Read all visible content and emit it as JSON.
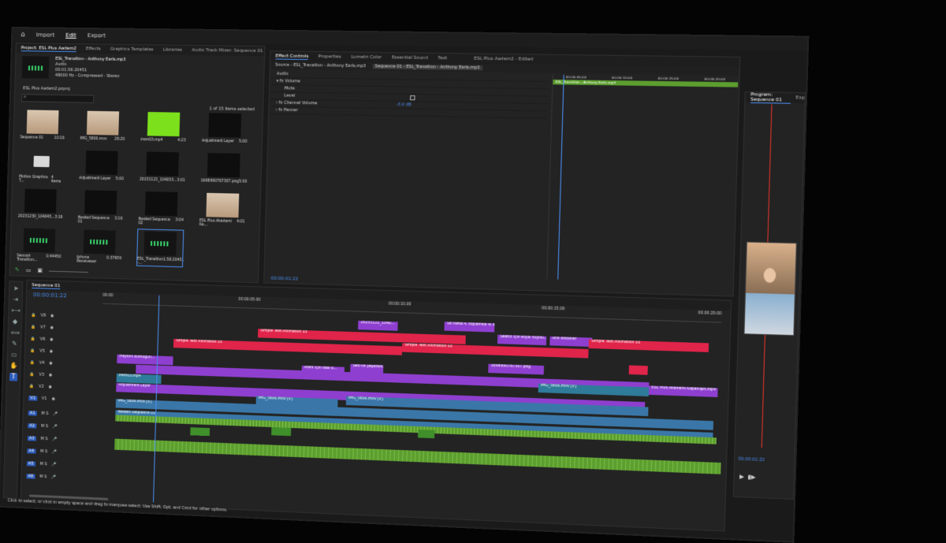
{
  "workspace": {
    "home": "⌂",
    "import": "Import",
    "edit": "Edit",
    "export": "Export"
  },
  "project": {
    "tabs": [
      "Project: ESL Plus Aadem2",
      "Effects",
      "Graphics Templates",
      "Libraries",
      "Audio Track Mixer: Sequence 01"
    ],
    "preview_name": "ESL_Transition - Anthony Earls.mp3",
    "preview_type": "Audio",
    "preview_duration": "00:01:56:20451",
    "preview_info": "48000 Hz - Compressed - Stereo",
    "file": "ESL Plus Aadem2.prproj",
    "count": "1 of 15 items selected",
    "items": [
      {
        "name": "Sequence 01",
        "dur": "",
        "kind": "face"
      },
      {
        "name": "",
        "dur": "10:16",
        "kind": ""
      },
      {
        "name": "IMG_5800.mov",
        "dur": "28:20",
        "kind": "face"
      },
      {
        "name": "irem03.mp4",
        "dur": "4:23",
        "kind": "green"
      },
      {
        "name": "Adjustment Layer",
        "dur": "5:00",
        "kind": ""
      },
      {
        "name": "Motion Graphics T...",
        "dur": "4 items",
        "kind": "folder"
      },
      {
        "name": "Adjustment Layer",
        "dur": "5:00",
        "kind": ""
      },
      {
        "name": "20231121_104033...",
        "dur": "3:01",
        "kind": ""
      },
      {
        "name": "1698990767307.png",
        "dur": "5:00",
        "kind": ""
      },
      {
        "name": "20231230_104045...",
        "dur": "3:16",
        "kind": ""
      },
      {
        "name": "Nested Sequence 01",
        "dur": "3:16",
        "kind": ""
      },
      {
        "name": "Nested Sequence 02",
        "dur": "3:04",
        "kind": ""
      },
      {
        "name": "ESL Plus Akademi Ka...",
        "dur": "4:01",
        "kind": "face"
      },
      {
        "name": "Swoosh Transition...",
        "dur": "0:44450",
        "kind": "wave"
      },
      {
        "name": "Iphone Receiveser",
        "dur": "0:37659",
        "kind": "wave"
      },
      {
        "name": "ESL_Transition -...",
        "dur": "1:56:20451",
        "kind": "wave"
      }
    ]
  },
  "effect_controls": {
    "tabs": [
      "Effect Controls",
      "Properties",
      "Lumetri Color",
      "Essential Sound",
      "Text"
    ],
    "window_title": "ESL Plus Aadem2 - Edited",
    "source": "Source - ESL_Transition - Anthony Earls.mp3",
    "seq_chip": "Sequence 01 - ESL_Transition - Anthony Earls.mp3",
    "clip_bar": "ESL_Transition - Anthony Earls.mp3",
    "section": "Audio",
    "rows": [
      "Volume",
      "Mute",
      "Level",
      "Channel Volume",
      "Panner"
    ],
    "level_value": "-3.0 dB",
    "timecode": "00:00:01:22",
    "ruler": [
      "00:00:05:00",
      "00:00:10:00",
      "00:00:15:00",
      "00:00:20:00"
    ]
  },
  "program": {
    "tabs": [
      "Program: Sequence 01",
      "Exp"
    ],
    "timecode": "00:00:01:22"
  },
  "timeline": {
    "title": "Sequence 01",
    "timecode": "00:00:01:22",
    "ruler": [
      "00:00",
      "00:00:05:00",
      "00:00:10:00",
      "00:00:15:00",
      "00:00:20:00"
    ],
    "tracks_v": [
      "V8",
      "V7",
      "V6",
      "V5",
      "V4",
      "V3",
      "V2",
      "V1"
    ],
    "tracks_a": [
      "A1",
      "A2",
      "A3",
      "A4",
      "A5",
      "A6"
    ],
    "clips": {
      "c1": "20231121_1040...",
      "c2": "Sıt hafta 4. toplamda 4/ kere",
      "c3": "Saatin için Ikiysi duydu...",
      "c4": "Ank erksiner",
      "c5": "Simple Text Animation 03",
      "c6": "Simple Text Animation 03",
      "c7": "Simple Text Animation 03",
      "c8": "Simple Text Animation 03",
      "c9": "Haydini kurduğun...",
      "c10": "Adım için dasl b...",
      "c11": "Seti ve yeşeradı...",
      "c12": "1698990767307.png",
      "c13": "irem03.mp4",
      "c14": "IMG_5800.mov [V]",
      "c15": "Adjustment Layer",
      "c16": "ESL Plus Akademi Kapanışlıt.mp4",
      "c17": "IMG_5800.mov [V]",
      "c18": "IMG_5800.mov [V]",
      "c19": "IMG_5800.mov [V]",
      "c20": "Nested Sequence 01"
    }
  },
  "status": "Click to select, or click in empty space and drag to marquee select. Use Shift, Opt, and Cmd for other options.",
  "colors": {
    "accent": "#4a8df0",
    "video_blue": "#3a77a8",
    "text_red": "#e0244a",
    "graphic_purple": "#8e3fcf",
    "audio_green": "#5c9e2f",
    "panel": "#232323"
  }
}
